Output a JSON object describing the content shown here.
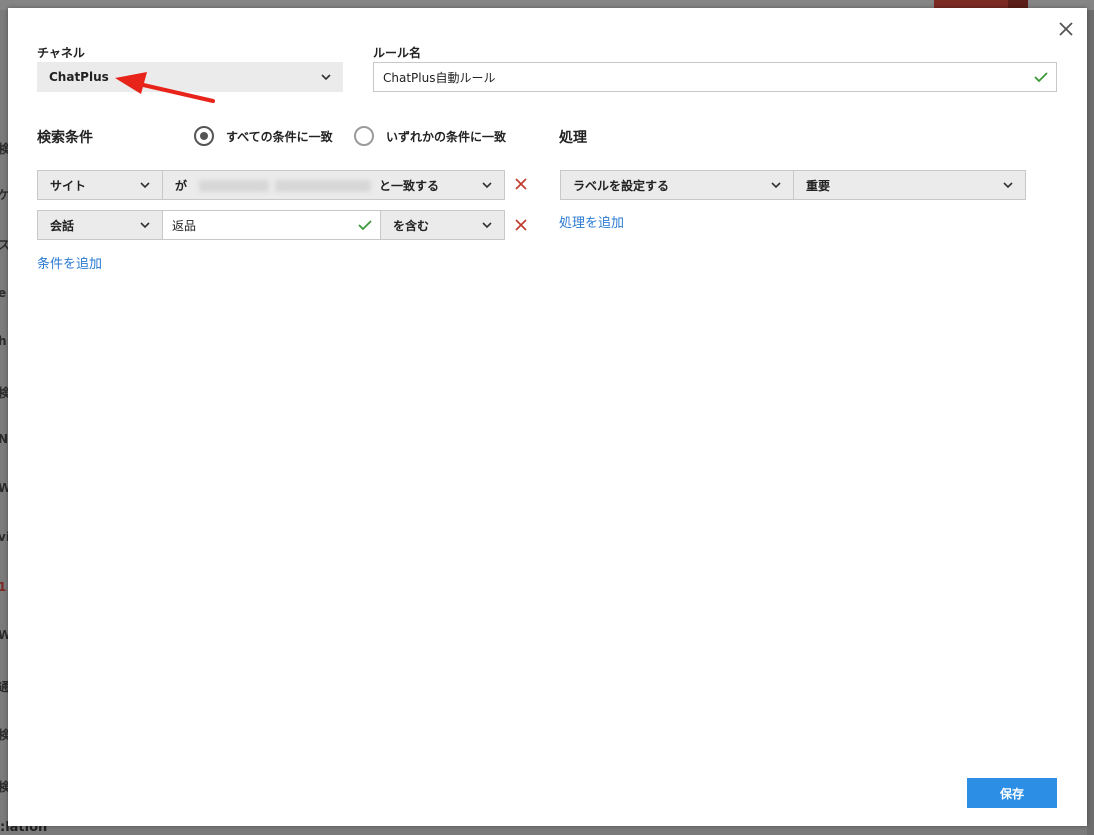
{
  "background": {
    "fragments": [
      "検",
      "ケ",
      "ス",
      "e",
      "h",
      "検",
      "N",
      "W",
      "vi",
      "1",
      "W",
      "通",
      "検",
      "検"
    ],
    "bottom_text": ":lation"
  },
  "modal": {
    "channel": {
      "label": "チャネル",
      "selected": "ChatPlus"
    },
    "rule_name": {
      "label": "ルール名",
      "value": "ChatPlus自動ルール"
    },
    "conditions": {
      "title": "検索条件",
      "match_all_label": "すべての条件に一致",
      "match_any_label": "いずれかの条件に一致",
      "selected_match": "all",
      "rows": [
        {
          "field": "サイト",
          "value_prefix": "が",
          "operator": "と一致する"
        },
        {
          "field": "会話",
          "value": "返品",
          "operator": "を含む"
        }
      ],
      "add_label": "条件を追加"
    },
    "actions": {
      "title": "処理",
      "rows": [
        {
          "action": "ラベルを設定する",
          "value": "重要"
        }
      ],
      "add_label": "処理を追加"
    },
    "save_label": "保存"
  },
  "colors": {
    "accent": "#2d8ee5",
    "link": "#2a7ad2",
    "remove": "#c0392b",
    "valid_check": "#3a9a3a",
    "annotation_arrow": "#e8231a"
  },
  "icons": {
    "close": "close-icon",
    "chevron": "chevron-down-icon",
    "check": "check-icon",
    "remove": "remove-icon"
  }
}
